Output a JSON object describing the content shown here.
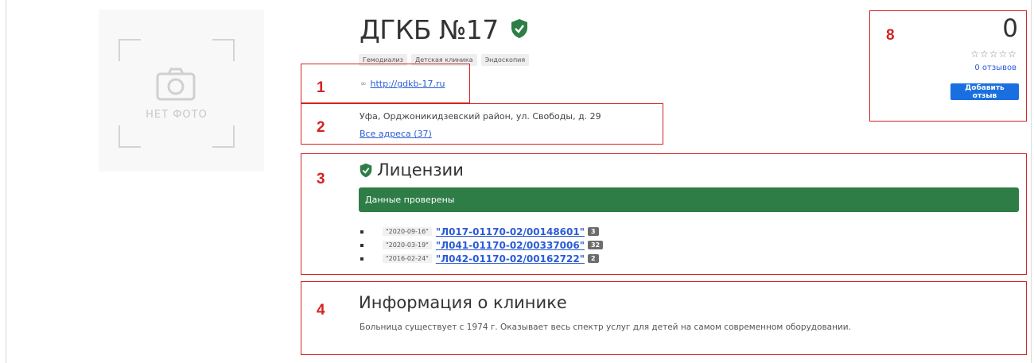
{
  "clinic": {
    "name": "ДГКБ №17",
    "tags": [
      "Гемодиализ",
      "Детская клиника",
      "Эндоскопия"
    ],
    "website": "http://gdkb-17.ru",
    "address": "Уфа, Орджоникидзевский район, ул. Свободы, д. 29",
    "all_addresses": "Все адреса (37)",
    "no_photo": "НЕТ ФОТО"
  },
  "licenses": {
    "title": "Лицензии",
    "verified_label": "Данные проверены",
    "items": [
      {
        "date": "\"2020-09-16\"",
        "number": "\"Л017-01170-02/00148601\"",
        "count": "3"
      },
      {
        "date": "\"2020-03-19\"",
        "number": "\"Л041-01170-02/00337006\"",
        "count": "32"
      },
      {
        "date": "\"2016-02-24\"",
        "number": "\"Л042-01170-02/00162722\"",
        "count": "2"
      }
    ]
  },
  "info": {
    "title": "Информация о клинике",
    "text": "Больница существует с 1974 г. Оказывает весь спектр услуг для детей на самом современном оборудовании."
  },
  "rating": {
    "value": "0",
    "stars": "☆☆☆☆☆",
    "reviews_link": "0 отзывов",
    "add_review_label": "Добавить отзыв"
  },
  "annotations": {
    "labels": [
      "1",
      "2",
      "3",
      "4",
      "8"
    ],
    "color": "#d62222"
  },
  "colors": {
    "accent": "#1a6fe0",
    "verified_green": "#2e7d46",
    "link": "#2a5bd7"
  }
}
